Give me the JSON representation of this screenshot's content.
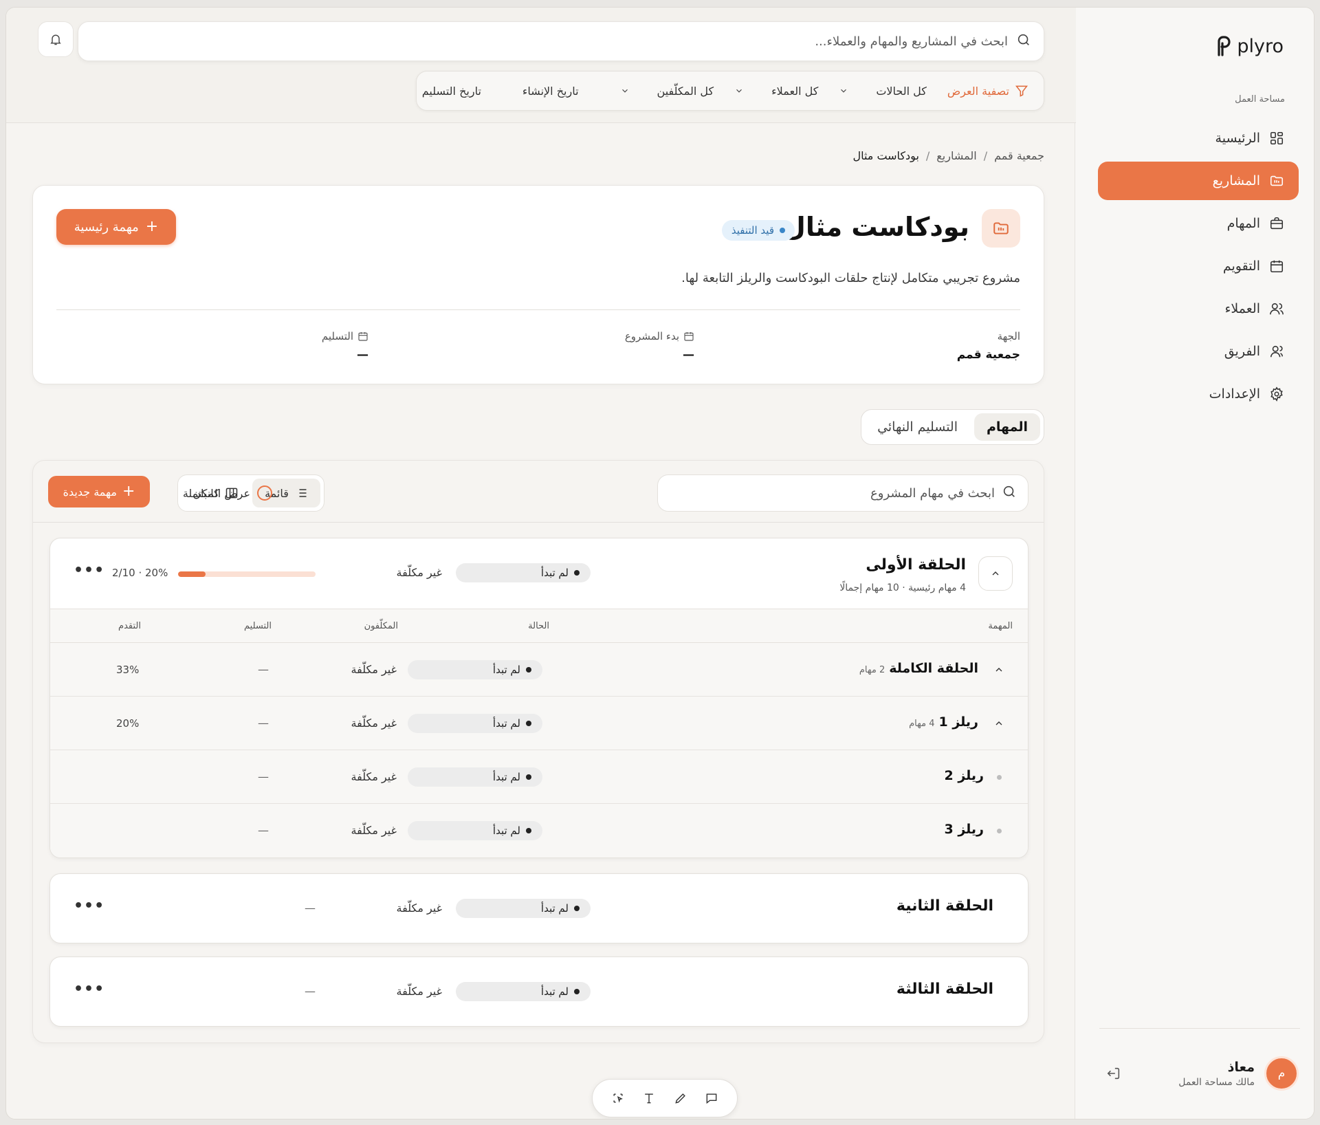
{
  "app": {
    "brand": "plyro"
  },
  "sidebar": {
    "workspace_label": "مساحة العمل",
    "items": [
      {
        "label": "الرئيسية",
        "icon": "dashboard-icon"
      },
      {
        "label": "المشاريع",
        "icon": "projects-icon",
        "active": true
      },
      {
        "label": "المهام",
        "icon": "briefcase-icon"
      },
      {
        "label": "التقويم",
        "icon": "calendar-icon"
      },
      {
        "label": "العملاء",
        "icon": "users-icon"
      },
      {
        "label": "الفريق",
        "icon": "team-icon"
      },
      {
        "label": "الإعدادات",
        "icon": "gear-icon"
      }
    ],
    "user": {
      "initial": "م",
      "name": "معاذ",
      "role": "مالك مساحة العمل"
    }
  },
  "topbar": {
    "search_placeholder": "ابحث في المشاريع والمهام والعملاء...",
    "filters": {
      "title": "تصفية العرض",
      "status": "كل الحالات",
      "clients": "كل العملاء",
      "assignees": "كل المكلّفين",
      "created": "تاريخ الإنشاء",
      "delivery": "تاريخ التسليم"
    }
  },
  "breadcrumb": [
    "جمعية قمم",
    "المشاريع",
    "بودكاست مثال"
  ],
  "project": {
    "title": "بودكاست مثال",
    "status": "قيد التنفيذ",
    "main_task_button": "مهمة رئيسية",
    "description": "مشروع تجريبي متكامل لإنتاج حلقات البودكاست والريلز التابعة لها.",
    "meta": {
      "client_label": "الجهة",
      "client_value": "جمعية قمم",
      "start_label": "بدء المشروع",
      "start_value": "—",
      "delivery_label": "التسليم",
      "delivery_value": "—"
    }
  },
  "tabs": [
    "المهام",
    "التسليم النهائي"
  ],
  "tasks": {
    "search_placeholder": "ابحث في مهام المشروع",
    "view_list": "قائمة",
    "view_kanban": "كانبان",
    "show_completed": "عرض المكتملة",
    "new_task": "مهمة جديدة",
    "columns": {
      "task": "المهمة",
      "status": "الحالة",
      "assignees": "المكلّفون",
      "delivery": "التسليم",
      "progress": "التقدم"
    },
    "episodes": [
      {
        "title": "الحلقة الأولى",
        "subtitle": "4 مهام رئيسية · 10 مهام إجمالًا",
        "status": "لم تبدأ",
        "assignee": "غير مكلّفة",
        "progress_text": "20% · 2/10",
        "progress": 0.2,
        "rows": [
          {
            "title": "الحلقة الكاملة",
            "count": "2 مهام",
            "status": "لم تبدأ",
            "assignee": "غير مكلّفة",
            "delivery": "—",
            "progress": "33%"
          },
          {
            "title": "ريلز 1",
            "count": "4 مهام",
            "status": "لم تبدأ",
            "assignee": "غير مكلّفة",
            "delivery": "—",
            "progress": "20%"
          },
          {
            "title": "ريلز 2",
            "status": "لم تبدأ",
            "assignee": "غير مكلّفة",
            "delivery": "—"
          },
          {
            "title": "ريلز 3",
            "status": "لم تبدأ",
            "assignee": "غير مكلّفة",
            "delivery": "—"
          }
        ]
      },
      {
        "title": "الحلقة الثانية",
        "status": "لم تبدأ",
        "assignee": "غير مكلّفة",
        "delivery": "—"
      },
      {
        "title": "الحلقة الثالثة",
        "status": "لم تبدأ",
        "assignee": "غير مكلّفة",
        "delivery": "—"
      }
    ]
  },
  "toolbar": {
    "icons": [
      "select-icon",
      "text-icon",
      "pen-icon",
      "comment-icon"
    ]
  },
  "colors": {
    "accent": "#ea7647",
    "status_blue": "#3a86c8"
  }
}
